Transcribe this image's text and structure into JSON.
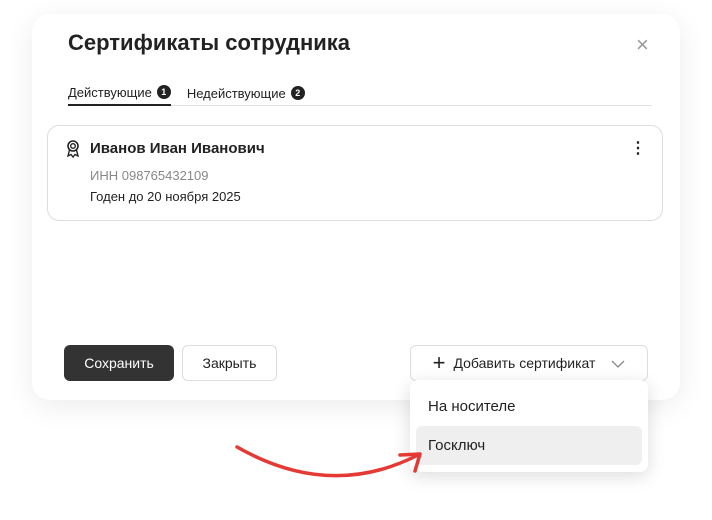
{
  "dialog": {
    "title": "Сертификаты сотрудника",
    "close_icon": "×"
  },
  "tabs": [
    {
      "label": "Действующие",
      "count": "1"
    },
    {
      "label": "Недействующие",
      "count": "2"
    }
  ],
  "certificate": {
    "name": "Иванов Иван Иванович",
    "inn": "ИНН 098765432109",
    "valid_until": "Годен до 20 ноября 2025"
  },
  "buttons": {
    "save": "Сохранить",
    "close": "Закрыть",
    "add": "Добавить сертификат"
  },
  "menu": {
    "items": [
      "На носителе",
      "Госключ"
    ]
  },
  "colors": {
    "arrow": "#e53935"
  }
}
